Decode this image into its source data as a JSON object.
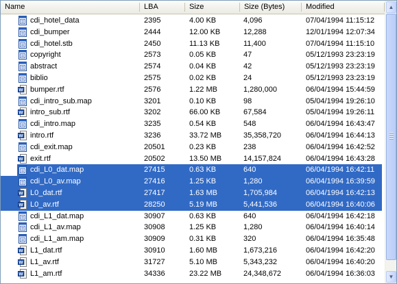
{
  "columns": {
    "name": "Name",
    "lba": "LBA",
    "size": "Size",
    "size_bytes": "Size (Bytes)",
    "modified": "Modified"
  },
  "rows": [
    {
      "name": "cdi_hotel_data",
      "icon": "file-icon",
      "lba": "2395",
      "size": "4.00 KB",
      "bytes": "4,096",
      "modified": "07/04/1994 11:15:12",
      "selected": false
    },
    {
      "name": "cdi_bumper",
      "icon": "file-icon",
      "lba": "2444",
      "size": "12.00 KB",
      "bytes": "12,288",
      "modified": "12/01/1994 12:07:34",
      "selected": false
    },
    {
      "name": "cdi_hotel.stb",
      "icon": "file-icon",
      "lba": "2450",
      "size": "11.13 KB",
      "bytes": "11,400",
      "modified": "07/04/1994 11:15:10",
      "selected": false
    },
    {
      "name": "copyright",
      "icon": "file-icon",
      "lba": "2573",
      "size": "0.05 KB",
      "bytes": "47",
      "modified": "05/12/1993 23:23:19",
      "selected": false
    },
    {
      "name": "abstract",
      "icon": "file-icon",
      "lba": "2574",
      "size": "0.04 KB",
      "bytes": "42",
      "modified": "05/12/1993 23:23:19",
      "selected": false
    },
    {
      "name": "biblio",
      "icon": "file-icon",
      "lba": "2575",
      "size": "0.02 KB",
      "bytes": "24",
      "modified": "05/12/1993 23:23:19",
      "selected": false
    },
    {
      "name": "bumper.rtf",
      "icon": "word-doc-icon",
      "lba": "2576",
      "size": "1.22 MB",
      "bytes": "1,280,000",
      "modified": "06/04/1994 15:44:59",
      "selected": false
    },
    {
      "name": "cdi_intro_sub.map",
      "icon": "file-icon",
      "lba": "3201",
      "size": "0.10 KB",
      "bytes": "98",
      "modified": "05/04/1994 19:26:10",
      "selected": false
    },
    {
      "name": "intro_sub.rtf",
      "icon": "word-doc-icon",
      "lba": "3202",
      "size": "66.00 KB",
      "bytes": "67,584",
      "modified": "05/04/1994 19:26:11",
      "selected": false
    },
    {
      "name": "cdi_intro.map",
      "icon": "file-icon",
      "lba": "3235",
      "size": "0.54 KB",
      "bytes": "548",
      "modified": "06/04/1994 16:43:47",
      "selected": false
    },
    {
      "name": "intro.rtf",
      "icon": "word-doc-icon",
      "lba": "3236",
      "size": "33.72 MB",
      "bytes": "35,358,720",
      "modified": "06/04/1994 16:44:13",
      "selected": false
    },
    {
      "name": "cdi_exit.map",
      "icon": "file-icon",
      "lba": "20501",
      "size": "0.23 KB",
      "bytes": "238",
      "modified": "06/04/1994 16:42:52",
      "selected": false
    },
    {
      "name": "exit.rtf",
      "icon": "word-doc-icon",
      "lba": "20502",
      "size": "13.50 MB",
      "bytes": "14,157,824",
      "modified": "06/04/1994 16:43:28",
      "selected": false
    },
    {
      "name": "cdi_L0_dat.map",
      "icon": "file-icon",
      "lba": "27415",
      "size": "0.63 KB",
      "bytes": "640",
      "modified": "06/04/1994 16:42:11",
      "selected": true
    },
    {
      "name": "cdi_L0_av.map",
      "icon": "file-icon",
      "lba": "27416",
      "size": "1.25 KB",
      "bytes": "1,280",
      "modified": "06/04/1994 16:39:59",
      "selected": true
    },
    {
      "name": "L0_dat.rtf",
      "icon": "word-doc-icon",
      "lba": "27417",
      "size": "1.63 MB",
      "bytes": "1,705,984",
      "modified": "06/04/1994 16:42:13",
      "selected": true
    },
    {
      "name": "L0_av.rtf",
      "icon": "word-doc-icon",
      "lba": "28250",
      "size": "5.19 MB",
      "bytes": "5,441,536",
      "modified": "06/04/1994 16:40:06",
      "selected": true
    },
    {
      "name": "cdi_L1_dat.map",
      "icon": "file-icon",
      "lba": "30907",
      "size": "0.63 KB",
      "bytes": "640",
      "modified": "06/04/1994 16:42:18",
      "selected": false
    },
    {
      "name": "cdi_L1_av.map",
      "icon": "file-icon",
      "lba": "30908",
      "size": "1.25 KB",
      "bytes": "1,280",
      "modified": "06/04/1994 16:40:14",
      "selected": false
    },
    {
      "name": "cdi_L1_am.map",
      "icon": "file-icon",
      "lba": "30909",
      "size": "0.31 KB",
      "bytes": "320",
      "modified": "06/04/1994 16:35:48",
      "selected": false
    },
    {
      "name": "L1_dat.rtf",
      "icon": "word-doc-icon",
      "lba": "30910",
      "size": "1.60 MB",
      "bytes": "1,673,216",
      "modified": "06/04/1994 16:42:20",
      "selected": false
    },
    {
      "name": "L1_av.rtf",
      "icon": "word-doc-icon",
      "lba": "31727",
      "size": "5.10 MB",
      "bytes": "5,343,232",
      "modified": "06/04/1994 16:40:20",
      "selected": false
    },
    {
      "name": "L1_am.rtf",
      "icon": "word-doc-icon",
      "lba": "34336",
      "size": "23.22 MB",
      "bytes": "24,348,672",
      "modified": "06/04/1994 16:36:03",
      "selected": false
    }
  ],
  "colors": {
    "selection": "#316ac5",
    "header_bg": "#ebeae2",
    "border": "#7f9db9"
  }
}
